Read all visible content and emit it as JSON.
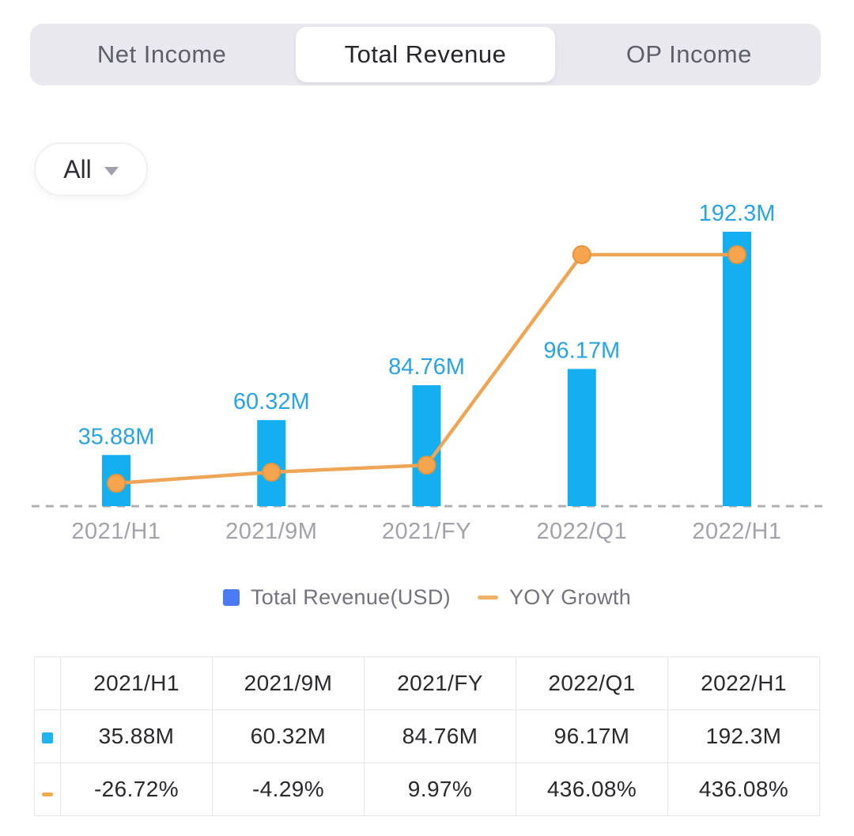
{
  "tab_bar": {
    "items": [
      {
        "label": "Net Income",
        "active": false
      },
      {
        "label": "Total Revenue",
        "active": true
      },
      {
        "label": "OP Income",
        "active": false
      }
    ]
  },
  "filter": {
    "value": "All"
  },
  "chart_data": {
    "type": "bar+line",
    "categories": [
      "2021/H1",
      "2021/9M",
      "2021/FY",
      "2022/Q1",
      "2022/H1"
    ],
    "series": [
      {
        "name": "Total Revenue(USD)",
        "type": "bar",
        "unit": "M",
        "values": [
          35.88,
          60.32,
          84.76,
          96.17,
          192.3
        ],
        "labels": [
          "35.88M",
          "60.32M",
          "84.76M",
          "96.17M",
          "192.3M"
        ],
        "color": "#14AFF0",
        "label_color": "#2BA3DE"
      },
      {
        "name": "YOY Growth",
        "type": "line",
        "unit": "%",
        "values": [
          -26.72,
          -4.29,
          9.97,
          436.08,
          436.08
        ],
        "labels": [
          "-26.72%",
          "-4.29%",
          "9.97%",
          "436.08%",
          "436.08%"
        ],
        "color": "#EFA556",
        "point_fill": "#F4A54E",
        "point_stroke": "#E5953C"
      }
    ],
    "title": "",
    "xlabel": "",
    "ylabel": "",
    "value_axis_hidden": true,
    "grid": false,
    "zero_baseline": "dashed",
    "legend_position": "bottom"
  },
  "legend": {
    "items": [
      {
        "label": "Total Revenue(USD)",
        "swatch": "square"
      },
      {
        "label": "YOY Growth",
        "swatch": "dash"
      }
    ]
  },
  "table": {
    "headers": [
      "2021/H1",
      "2021/9M",
      "2021/FY",
      "2022/Q1",
      "2022/H1"
    ],
    "revenue_row": {
      "icon": "cyan-square",
      "cells": [
        "35.88M",
        "60.32M",
        "84.76M",
        "96.17M",
        "192.3M"
      ]
    },
    "yoy_row": {
      "icon": "orange-dash",
      "cells": [
        {
          "text": "-26.72%",
          "tone": "negative"
        },
        {
          "text": "-4.29%",
          "tone": "negative"
        },
        {
          "text": "9.97%",
          "tone": "positive"
        },
        {
          "text": "436.08%",
          "tone": "positive"
        },
        {
          "text": "436.08%",
          "tone": "positive"
        }
      ]
    }
  },
  "colors": {
    "text_dark": "#2A2A2E",
    "tab_bar_bg": "#E8E8EE",
    "tab_inactive_text": "#5F5F6A",
    "tab_active_text": "#26262C",
    "bar": "#14AFF0",
    "bar_label": "#2BA3DE",
    "line": "#EFA556",
    "axis_label": "#A2A2AB",
    "dashed_baseline": "#AFAFB6",
    "legend_bar_swatch": "#4A7BF3",
    "legend_line_swatch": "#EFB266",
    "legend_text": "#73737E",
    "table_border": "#E4E4E8",
    "table_bar_swatch": "#1FB4F1",
    "table_line_swatch": "#F2A94C",
    "positive": "#3CAC88",
    "negative": "#D9605A"
  }
}
